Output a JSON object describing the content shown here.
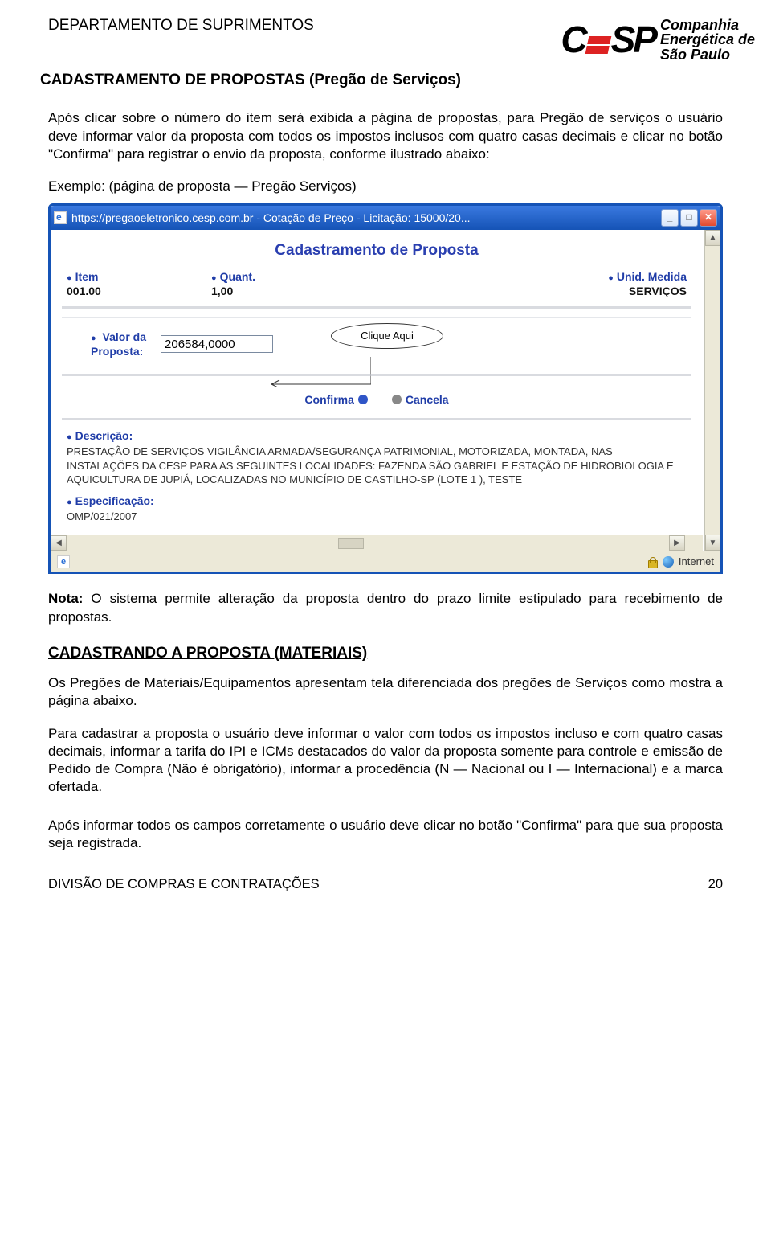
{
  "header": {
    "department": "DEPARTAMENTO DE SUPRIMENTOS",
    "doc_title": "CADASTRAMENTO DE PROPOSTAS (Pregão de Serviços)",
    "company_lines": [
      "Companhia",
      "Energética de",
      "São Paulo"
    ]
  },
  "body": {
    "p1": "Após clicar sobre o número do item será exibida a página de propostas, para Pregão de serviços o usuário deve informar valor da proposta com todos os impostos inclusos com quatro casas decimais e clicar no botão \"Confirma\" para registrar o envio da proposta, conforme ilustrado abaixo:",
    "example": "Exemplo: (página de proposta — Pregão Serviços)",
    "nota": "Nota: O sistema permite alteração da proposta dentro do prazo limite estipulado para recebimento de propostas.",
    "sec_title": "CADASTRANDO A PROPOSTA (MATERIAIS)",
    "p2": "Os Pregões de Materiais/Equipamentos apresentam tela diferenciada dos pregões de Serviços como mostra a página abaixo.",
    "p3": "Para cadastrar a proposta o usuário deve informar o valor com todos os impostos incluso e com quatro casas decimais, informar a tarifa do IPI e ICMs destacados do valor da proposta somente para controle e emissão de Pedido de Compra (Não é obrigatório), informar a procedência (N — Nacional ou I — Internacional) e a marca ofertada.",
    "p4": "Após informar todos os campos corretamente o usuário deve clicar no botão \"Confirma\" para que sua proposta seja registrada."
  },
  "window": {
    "title": "https://pregaoeletronico.cesp.com.br - Cotação de Preço - Licitação: 15000/20...",
    "panel_title": "Cadastramento de Proposta",
    "cols": {
      "item_label": "Item",
      "item_value": "001.00",
      "quant_label": "Quant.",
      "quant_value": "1,00",
      "unid_label": "Unid. Medida",
      "unid_value": "SERVIÇOS"
    },
    "valor": {
      "label1": "Valor da",
      "label2": "Proposta:",
      "value": "206584,0000"
    },
    "callout": "Clique Aqui",
    "buttons": {
      "confirm": "Confirma",
      "cancel": "Cancela"
    },
    "descricao": {
      "label": "Descrição:",
      "text": "PRESTAÇÃO DE SERVIÇOS VIGILÂNCIA ARMADA/SEGURANÇA PATRIMONIAL, MOTORIZADA, MONTADA, NAS INSTALAÇÕES DA CESP PARA AS SEGUINTES LOCALIDADES: FAZENDA SÃO GABRIEL E ESTAÇÃO DE HIDROBIOLOGIA E AQUICULTURA DE JUPIÁ, LOCALIZADAS NO MUNICÍPIO DE CASTILHO-SP (LOTE 1 ), TESTE"
    },
    "espec": {
      "label": "Especificação:",
      "text": "OMP/021/2007"
    },
    "status_zone": "Internet"
  },
  "footer": {
    "left": "DIVISÃO DE COMPRAS E CONTRATAÇÕES",
    "right": "20"
  }
}
